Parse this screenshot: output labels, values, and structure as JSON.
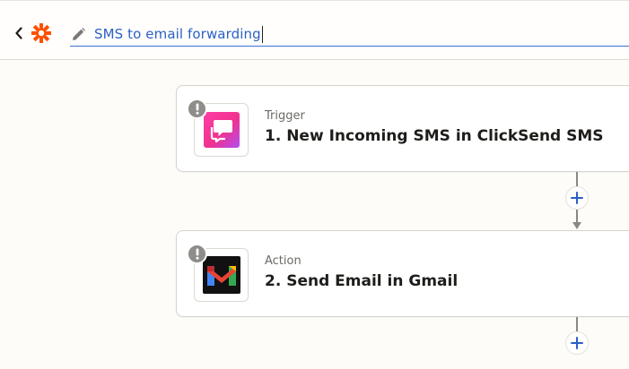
{
  "header": {
    "back_icon": "chevron-left-icon",
    "logo_icon": "zapier-asterisk-icon",
    "edit_icon": "pencil-icon",
    "zap_title": "SMS to email forwarding",
    "accent_color": "#ff4f00",
    "title_color": "#2b5fc4"
  },
  "steps": [
    {
      "type_label": "Trigger",
      "title": "1. New Incoming SMS in ClickSend SMS",
      "app_icon": "clicksend-sms-icon",
      "status_icon": "warning-icon"
    },
    {
      "type_label": "Action",
      "title": "2. Send Email in Gmail",
      "app_icon": "gmail-icon",
      "status_icon": "warning-icon"
    }
  ],
  "connectors": {
    "add_icon": "plus-icon"
  }
}
